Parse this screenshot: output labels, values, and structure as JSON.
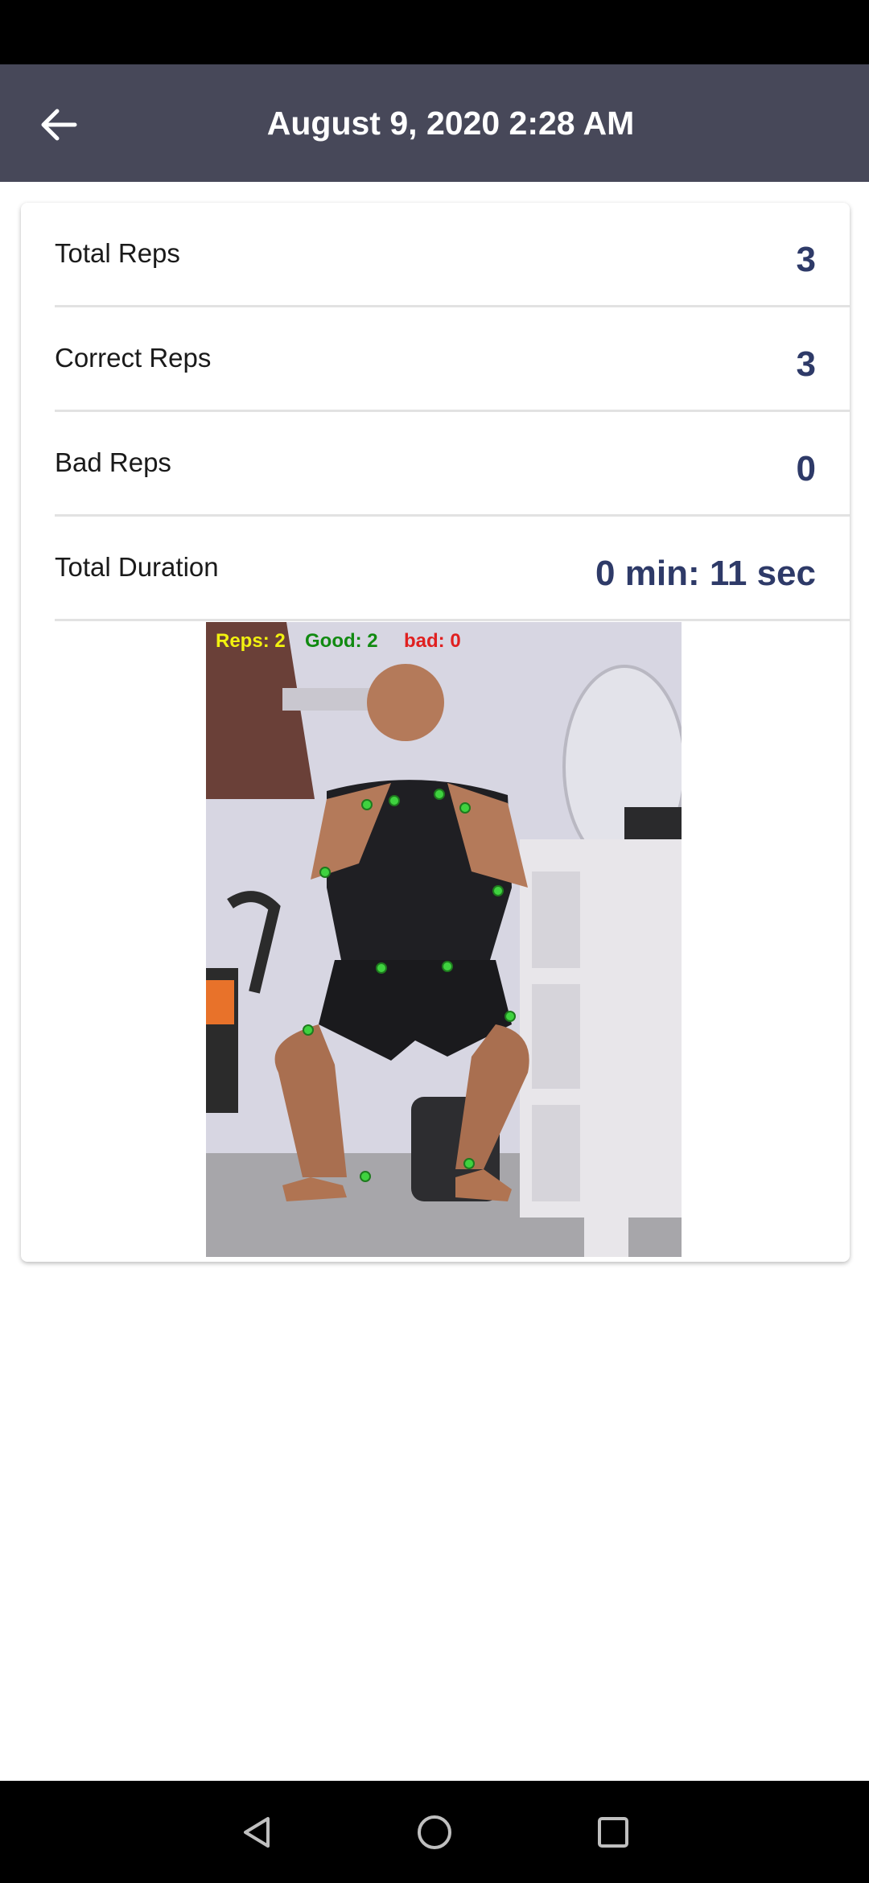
{
  "header": {
    "title": "August 9, 2020 2:28 AM"
  },
  "stats": [
    {
      "label": "Total Reps",
      "value": "3"
    },
    {
      "label": "Correct Reps",
      "value": "3"
    },
    {
      "label": "Bad Reps",
      "value": "0"
    },
    {
      "label": "Total Duration",
      "value": "0 min: 11 sec"
    }
  ],
  "photo_overlay": {
    "reps": "Reps: 2",
    "good": "Good: 2",
    "bad": "bad: 0"
  },
  "colors": {
    "app_bar": "#474859",
    "value_text": "#2e3a68",
    "overlay_reps": "#f2f20f",
    "overlay_good": "#118a11",
    "overlay_bad": "#e02020",
    "keypoint": "#3fd23f"
  },
  "icons": {
    "back": "arrow-left-icon",
    "nav_back": "triangle-back-icon",
    "nav_home": "circle-home-icon",
    "nav_recents": "square-recents-icon"
  }
}
